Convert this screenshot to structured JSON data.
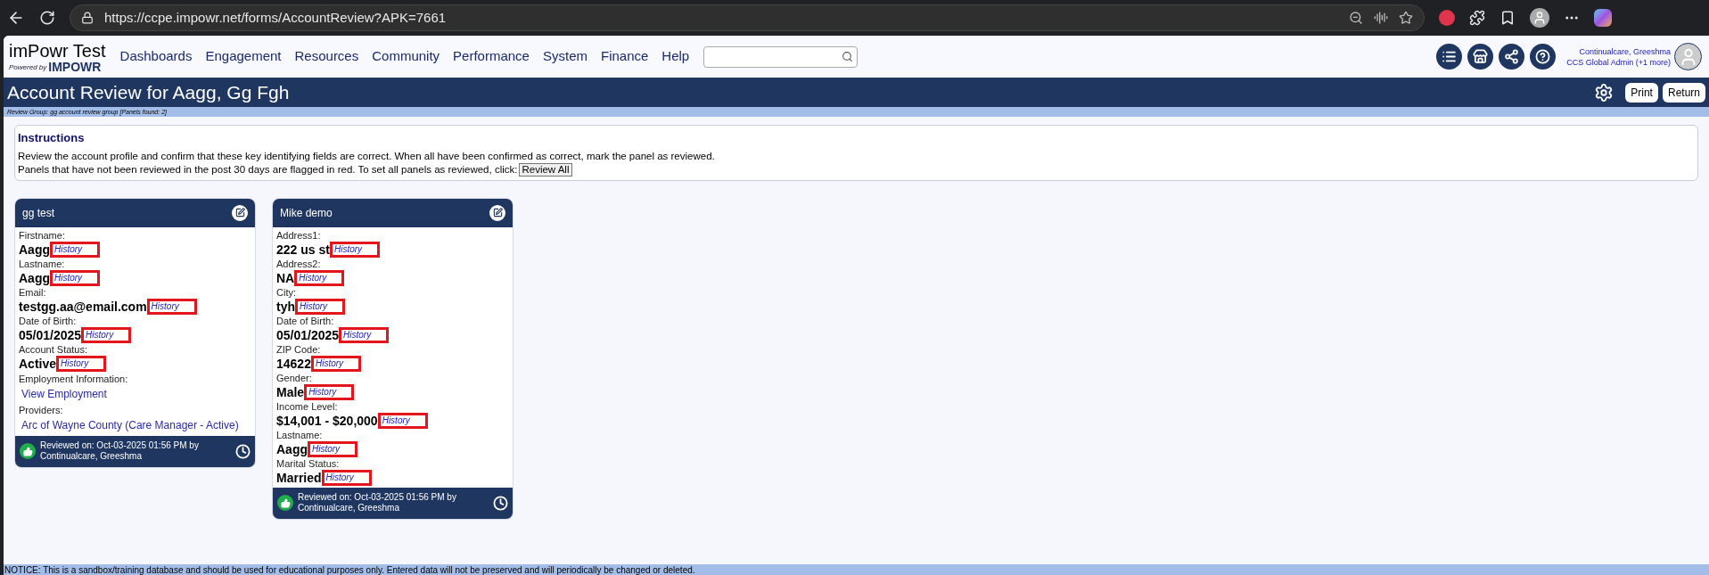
{
  "browser": {
    "url": "https://ccpe.impowr.net/forms/AccountReview?APK=7661"
  },
  "app": {
    "brand_title": "imPowr Test",
    "brand_powered": "Powered by",
    "brand_logo": "IMPOWR",
    "nav": [
      "Dashboards",
      "Engagement",
      "Resources",
      "Community",
      "Performance",
      "System",
      "Finance",
      "Help"
    ],
    "user": {
      "name": "Continualcare, Greeshma",
      "role": "CCS Global Admin (+1 more)"
    }
  },
  "page": {
    "title": "Account Review for Aagg, Gg Fgh",
    "actions": [
      "Print",
      "Return"
    ],
    "review_group": "Review Group: gg account review group [Panels found: 2]"
  },
  "instructions": {
    "title": "Instructions",
    "lines": [
      "Review the account profile and confirm that these key identifying fields are correct. When all have been confirmed as correct, mark the panel as reviewed.",
      "Panels that have not been reviewed in the post 30 days are flagged in red. To set all panels as reviewed, click:"
    ],
    "button": "Review All"
  },
  "panels": [
    {
      "title": "gg test",
      "fields": [
        {
          "kind": "history",
          "label": "Firstname:",
          "value": "Aagg",
          "link": "History",
          "highlighted": true
        },
        {
          "kind": "history",
          "label": "Lastname:",
          "value": "Aagg",
          "link": "History",
          "highlighted": true
        },
        {
          "kind": "history",
          "label": "Email:",
          "value": "testgg.aa@email.com",
          "link": "History",
          "highlighted": true
        },
        {
          "kind": "history",
          "label": "Date of Birth:",
          "value": "05/01/2025",
          "link": "History",
          "highlighted": true
        },
        {
          "kind": "history",
          "label": "Account Status:",
          "value": "Active",
          "link": "History",
          "highlighted": true
        },
        {
          "kind": "link",
          "label": "Employment Information:",
          "link": "View Employment"
        },
        {
          "kind": "link",
          "label": "Providers:",
          "link": "Arc of Wayne County (Care Manager - Active)"
        }
      ],
      "reviewed": true,
      "footer": [
        "Reviewed on: Oct-03-2025 01:56 PM by",
        "Continualcare, Greeshma"
      ]
    },
    {
      "title": "Mike demo",
      "fields": [
        {
          "kind": "history",
          "label": "Address1:",
          "value": "222 us st",
          "link": "History",
          "highlighted": true
        },
        {
          "kind": "history",
          "label": "Address2:",
          "value": "NA",
          "link": "History",
          "highlighted": true
        },
        {
          "kind": "history",
          "label": "City:",
          "value": "tyh",
          "link": "History",
          "highlighted": true
        },
        {
          "kind": "history",
          "label": "Date of Birth:",
          "value": "05/01/2025",
          "link": "History",
          "highlighted": true
        },
        {
          "kind": "history",
          "label": "ZIP Code:",
          "value": "14622",
          "link": "History",
          "highlighted": true
        },
        {
          "kind": "history",
          "label": "Gender:",
          "value": "Male",
          "link": "History",
          "highlighted": true
        },
        {
          "kind": "history",
          "label": "Income Level:",
          "value": "$14,001 - $20,000",
          "link": "History",
          "highlighted": true
        },
        {
          "kind": "history",
          "label": "Lastname:",
          "value": "Aagg",
          "link": "History",
          "highlighted": true
        },
        {
          "kind": "history",
          "label": "Marital Status:",
          "value": "Married",
          "link": "History",
          "highlighted": true
        }
      ],
      "reviewed": true,
      "footer": [
        "Reviewed on: Oct-03-2025 01:56 PM by",
        "Continualcare, Greeshma"
      ]
    }
  ],
  "notice": "NOTICE: This is a sandbox/training database and should be used for educational purposes only. Entered data will not be preserved and will periodically be changed or deleted."
}
